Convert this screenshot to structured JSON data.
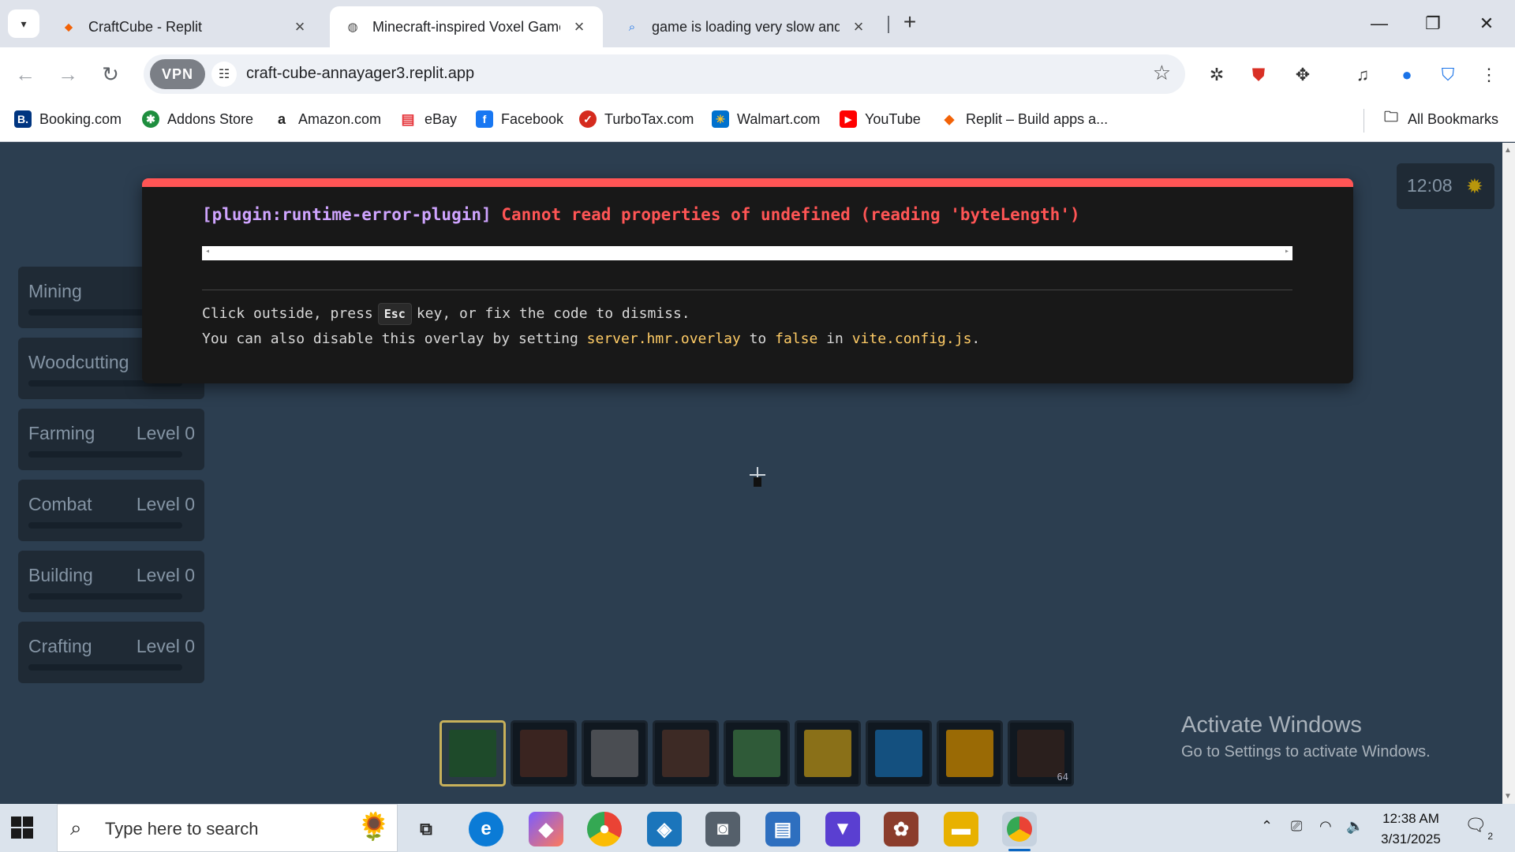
{
  "browser": {
    "tabs": [
      {
        "label": "CraftCube - Replit",
        "icon": "replit-icon",
        "active": false
      },
      {
        "label": "Minecraft-inspired Voxel Game",
        "icon": "globe-icon",
        "active": true
      },
      {
        "label": "game is loading very slow and i",
        "icon": "search-icon",
        "active": false
      }
    ],
    "new_tab": "+",
    "vpn_label": "VPN",
    "url": "craft-cube-annayager3.replit.app",
    "bookmarks": [
      {
        "label": "Booking.com",
        "icon": "booking-icon",
        "color": "#003580",
        "glyph": "B."
      },
      {
        "label": "Addons Store",
        "icon": "addons-store-icon",
        "color": "#1e8e3e",
        "glyph": "✱"
      },
      {
        "label": "Amazon.com",
        "icon": "amazon-icon",
        "color": "#222222",
        "glyph": "a"
      },
      {
        "label": "eBay",
        "icon": "ebay-icon",
        "color": "#e53238",
        "glyph": "▤"
      },
      {
        "label": "Facebook",
        "icon": "facebook-icon",
        "color": "#1877f2",
        "glyph": "f"
      },
      {
        "label": "TurboTax.com",
        "icon": "turbotax-icon",
        "color": "#d52b1e",
        "glyph": "✓"
      },
      {
        "label": "Walmart.com",
        "icon": "walmart-icon",
        "color": "#0071ce",
        "glyph": "✳"
      },
      {
        "label": "YouTube",
        "icon": "youtube-icon",
        "color": "#ff0000",
        "glyph": "▶"
      },
      {
        "label": "Replit – Build apps a...",
        "icon": "replit-icon",
        "color": "#f26207",
        "glyph": "⬥"
      }
    ],
    "all_bookmarks": "All Bookmarks"
  },
  "game": {
    "skills": [
      {
        "name": "Mining",
        "level": "L",
        "progress": 0
      },
      {
        "name": "Woodcutting",
        "level": "L",
        "progress": 0
      },
      {
        "name": "Farming",
        "level": "Level 0",
        "progress": 0
      },
      {
        "name": "Combat",
        "level": "Level 0",
        "progress": 0
      },
      {
        "name": "Building",
        "level": "Level 0",
        "progress": 0
      },
      {
        "name": "Crafting",
        "level": "Level 0",
        "progress": 0
      }
    ],
    "clock": "12:08",
    "hotbar": [
      {
        "color": "#1e4a2a",
        "selected": true,
        "count": ""
      },
      {
        "color": "#3a2420",
        "selected": false,
        "count": ""
      },
      {
        "color": "#4a4d52",
        "selected": false,
        "count": ""
      },
      {
        "color": "#3d2a25",
        "selected": false,
        "count": ""
      },
      {
        "color": "#2f5a38",
        "selected": false,
        "count": ""
      },
      {
        "color": "#8a7018",
        "selected": false,
        "count": ""
      },
      {
        "color": "#14507f",
        "selected": false,
        "count": ""
      },
      {
        "color": "#9a6a05",
        "selected": false,
        "count": ""
      },
      {
        "color": "#2a1f1d",
        "selected": false,
        "count": "64"
      }
    ]
  },
  "error_overlay": {
    "plugin": "[plugin:runtime-error-plugin]",
    "message": "Cannot read properties of undefined (reading 'byteLength')",
    "tip1_pre": "Click outside, press",
    "tip1_key": "Esc",
    "tip1_post": "key, or fix the code to dismiss.",
    "tip2_a": "You can also disable this overlay by setting",
    "tip2_code1": "server.hmr.overlay",
    "tip2_b": "to",
    "tip2_code2": "false",
    "tip2_c": "in",
    "tip2_code3": "vite.config.js",
    "tip2_d": "."
  },
  "watermark": {
    "title": "Activate Windows",
    "subtitle": "Go to Settings to activate Windows."
  },
  "taskbar": {
    "search_placeholder": "Type here to search",
    "time": "12:38 AM",
    "date": "3/31/2025",
    "notification_count": "2"
  }
}
